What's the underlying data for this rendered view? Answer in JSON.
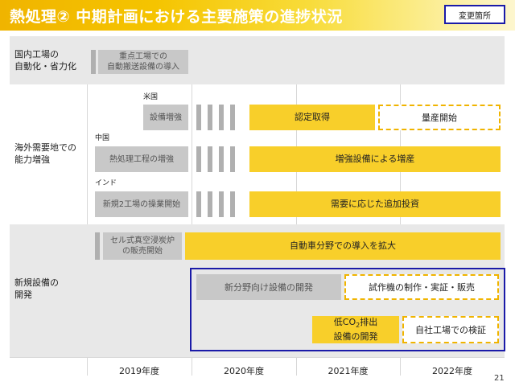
{
  "header": {
    "title": "熱処理② 中期計画における主要施策の進捗状況",
    "change_badge": "変更箇所"
  },
  "rows": {
    "domestic": {
      "label_line1": "国内工場の",
      "label_line2": "自動化・省力化",
      "bar_line1": "重点工場での",
      "bar_line2": "自動搬送設備の導入"
    },
    "overseas": {
      "label_line1": "海外需要地での",
      "label_line2": "能力増強",
      "us": {
        "region": "米国",
        "bar": "設備増強",
        "yellow": "認定取得",
        "dashed": "量産開始"
      },
      "china": {
        "region": "中国",
        "bar": "熱処理工程の増強",
        "yellow": "増強設備による増産"
      },
      "india": {
        "region": "インド",
        "bar": "新規2工場の操業開始",
        "yellow": "需要に応じた追加投資"
      }
    },
    "new_equipment": {
      "label_line1": "新規設備の",
      "label_line2": "開発",
      "bar_line1": "セル式真空浸炭炉",
      "bar_line2": "の販売開始",
      "yellow_auto": "自動車分野での導入を拡大",
      "gray_newfield": "新分野向け設備の開発",
      "dashed_prototype": "試作機の制作・実証・販売",
      "lowco2_line1_a": "低CO",
      "lowco2_sub": "2",
      "lowco2_line1_b": "排出",
      "lowco2_line2": "設備の開発",
      "dashed_verify": "自社工場での検証"
    }
  },
  "years": [
    "2019年度",
    "2020年度",
    "2021年度",
    "2022年度"
  ],
  "page_number": "21",
  "colors": {
    "accent_yellow": "#f8cf2a",
    "title_yellow": "#f0b400",
    "gray_bar": "#c8c8c8",
    "band_gray": "#e8e8e8",
    "highlight_blue": "#1a1aa8"
  }
}
